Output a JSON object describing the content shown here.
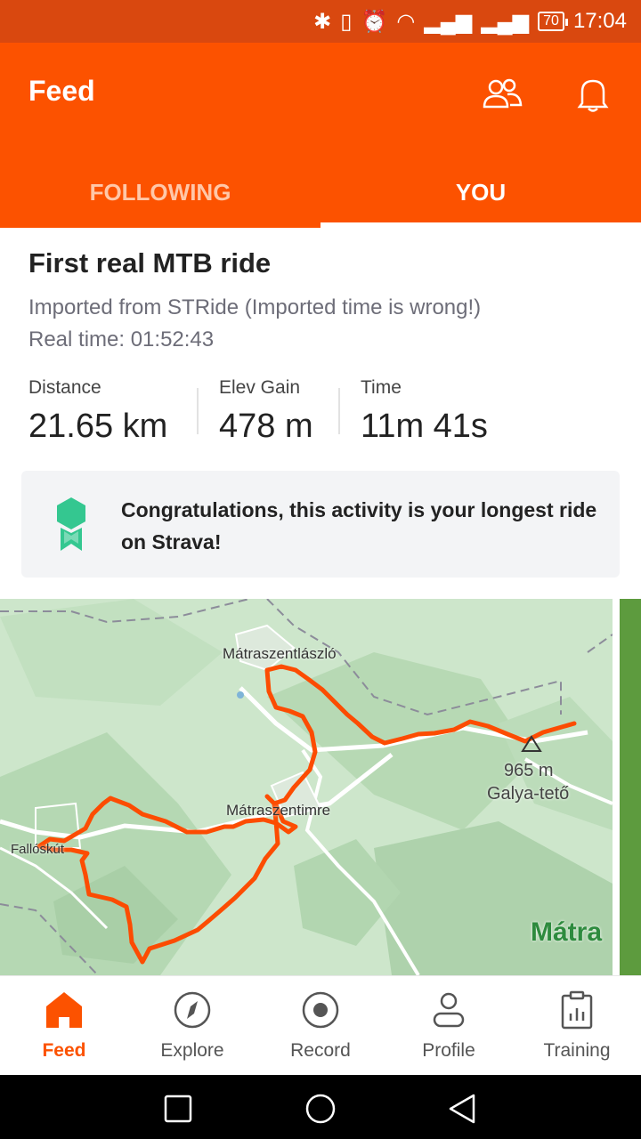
{
  "status_bar": {
    "battery": "70",
    "time": "17:04"
  },
  "header": {
    "title": "Feed"
  },
  "tabs": [
    {
      "label": "FOLLOWING"
    },
    {
      "label": "YOU"
    }
  ],
  "activity": {
    "title": "First real MTB ride",
    "description_line1": "Imported from STRide (Imported time is wrong!)",
    "description_line2": "Real time: 01:52:43",
    "stats": [
      {
        "label": "Distance",
        "value": "21.65 km"
      },
      {
        "label": "Elev Gain",
        "value": "478 m"
      },
      {
        "label": "Time",
        "value": "11m 41s"
      }
    ],
    "congrats": "Congratulations, this activity is your longest ride on Strava!"
  },
  "map": {
    "labels": {
      "town1": "Mátraszentlászló",
      "town2": "Mátraszentimre",
      "town3": "Fallóskút",
      "peak_elev": "965 m",
      "peak_name": "Galya-tető",
      "region": "Mátra"
    },
    "route_color": "#fc4c02"
  },
  "bottom_nav": [
    {
      "label": "Feed"
    },
    {
      "label": "Explore"
    },
    {
      "label": "Record"
    },
    {
      "label": "Profile"
    },
    {
      "label": "Training"
    }
  ],
  "colors": {
    "brand": "#fc5200",
    "status_bar": "#d9480f",
    "badge": "#34c790"
  }
}
